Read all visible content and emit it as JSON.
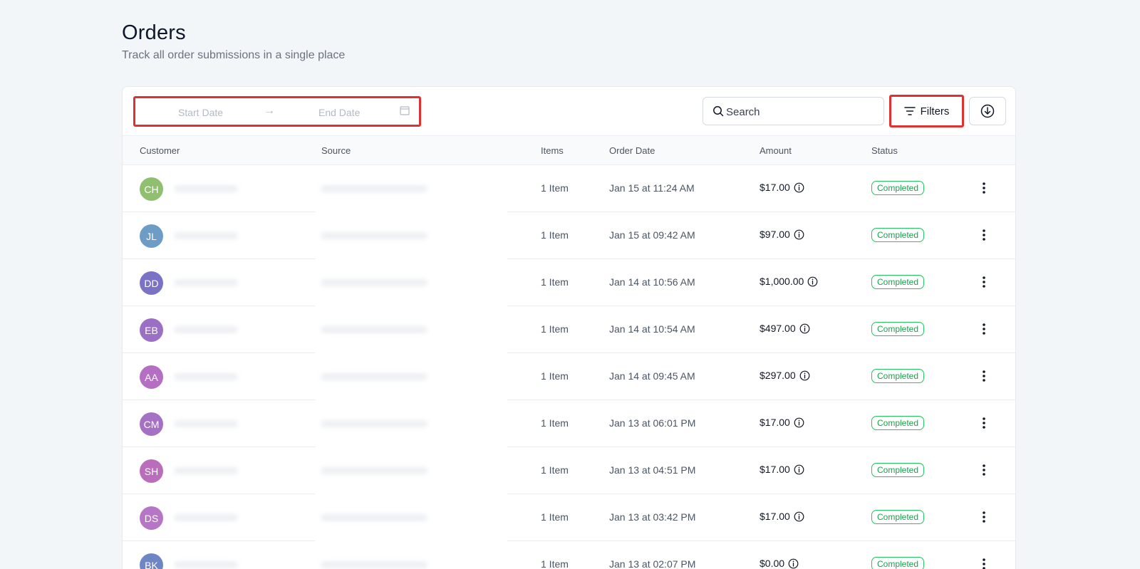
{
  "page": {
    "title": "Orders",
    "subtitle": "Track all order submissions in a single place"
  },
  "toolbar": {
    "start_date_placeholder": "Start Date",
    "arrow": "→",
    "end_date_placeholder": "End Date",
    "search_placeholder": "Search",
    "filters_label": "Filters"
  },
  "table": {
    "columns": [
      "Customer",
      "Source",
      "Items",
      "Order Date",
      "Amount",
      "Status"
    ],
    "rows": [
      {
        "initials": "CH",
        "avatar_color": "#8fbf6f",
        "items": "1 Item",
        "date": "Jan 15 at 11:24 AM",
        "amount": "$17.00",
        "status": "Completed"
      },
      {
        "initials": "JL",
        "avatar_color": "#6d9cc6",
        "items": "1 Item",
        "date": "Jan 15 at 09:42 AM",
        "amount": "$97.00",
        "status": "Completed"
      },
      {
        "initials": "DD",
        "avatar_color": "#7a72c4",
        "items": "1 Item",
        "date": "Jan 14 at 10:56 AM",
        "amount": "$1,000.00",
        "status": "Completed"
      },
      {
        "initials": "EB",
        "avatar_color": "#9a6fc4",
        "items": "1 Item",
        "date": "Jan 14 at 10:54 AM",
        "amount": "$497.00",
        "status": "Completed"
      },
      {
        "initials": "AA",
        "avatar_color": "#b46fc4",
        "items": "1 Item",
        "date": "Jan 14 at 09:45 AM",
        "amount": "$297.00",
        "status": "Completed"
      },
      {
        "initials": "CM",
        "avatar_color": "#a571c4",
        "items": "1 Item",
        "date": "Jan 13 at 06:01 PM",
        "amount": "$17.00",
        "status": "Completed"
      },
      {
        "initials": "SH",
        "avatar_color": "#b96dbb",
        "items": "1 Item",
        "date": "Jan 13 at 04:51 PM",
        "amount": "$17.00",
        "status": "Completed"
      },
      {
        "initials": "DS",
        "avatar_color": "#b775c6",
        "items": "1 Item",
        "date": "Jan 13 at 03:42 PM",
        "amount": "$17.00",
        "status": "Completed"
      },
      {
        "initials": "BK",
        "avatar_color": "#6f86c4",
        "items": "1 Item",
        "date": "Jan 13 at 02:07 PM",
        "amount": "$0.00",
        "status": "Completed"
      }
    ]
  },
  "icons": {
    "calendar": "calendar-icon",
    "search": "search-icon",
    "filter": "filter-icon",
    "download": "download-icon",
    "info": "info-icon",
    "more": "more-vertical-icon"
  },
  "colors": {
    "highlight_border": "#e03131",
    "status_green": "#16a34a",
    "page_bg": "#f2f6f9"
  }
}
